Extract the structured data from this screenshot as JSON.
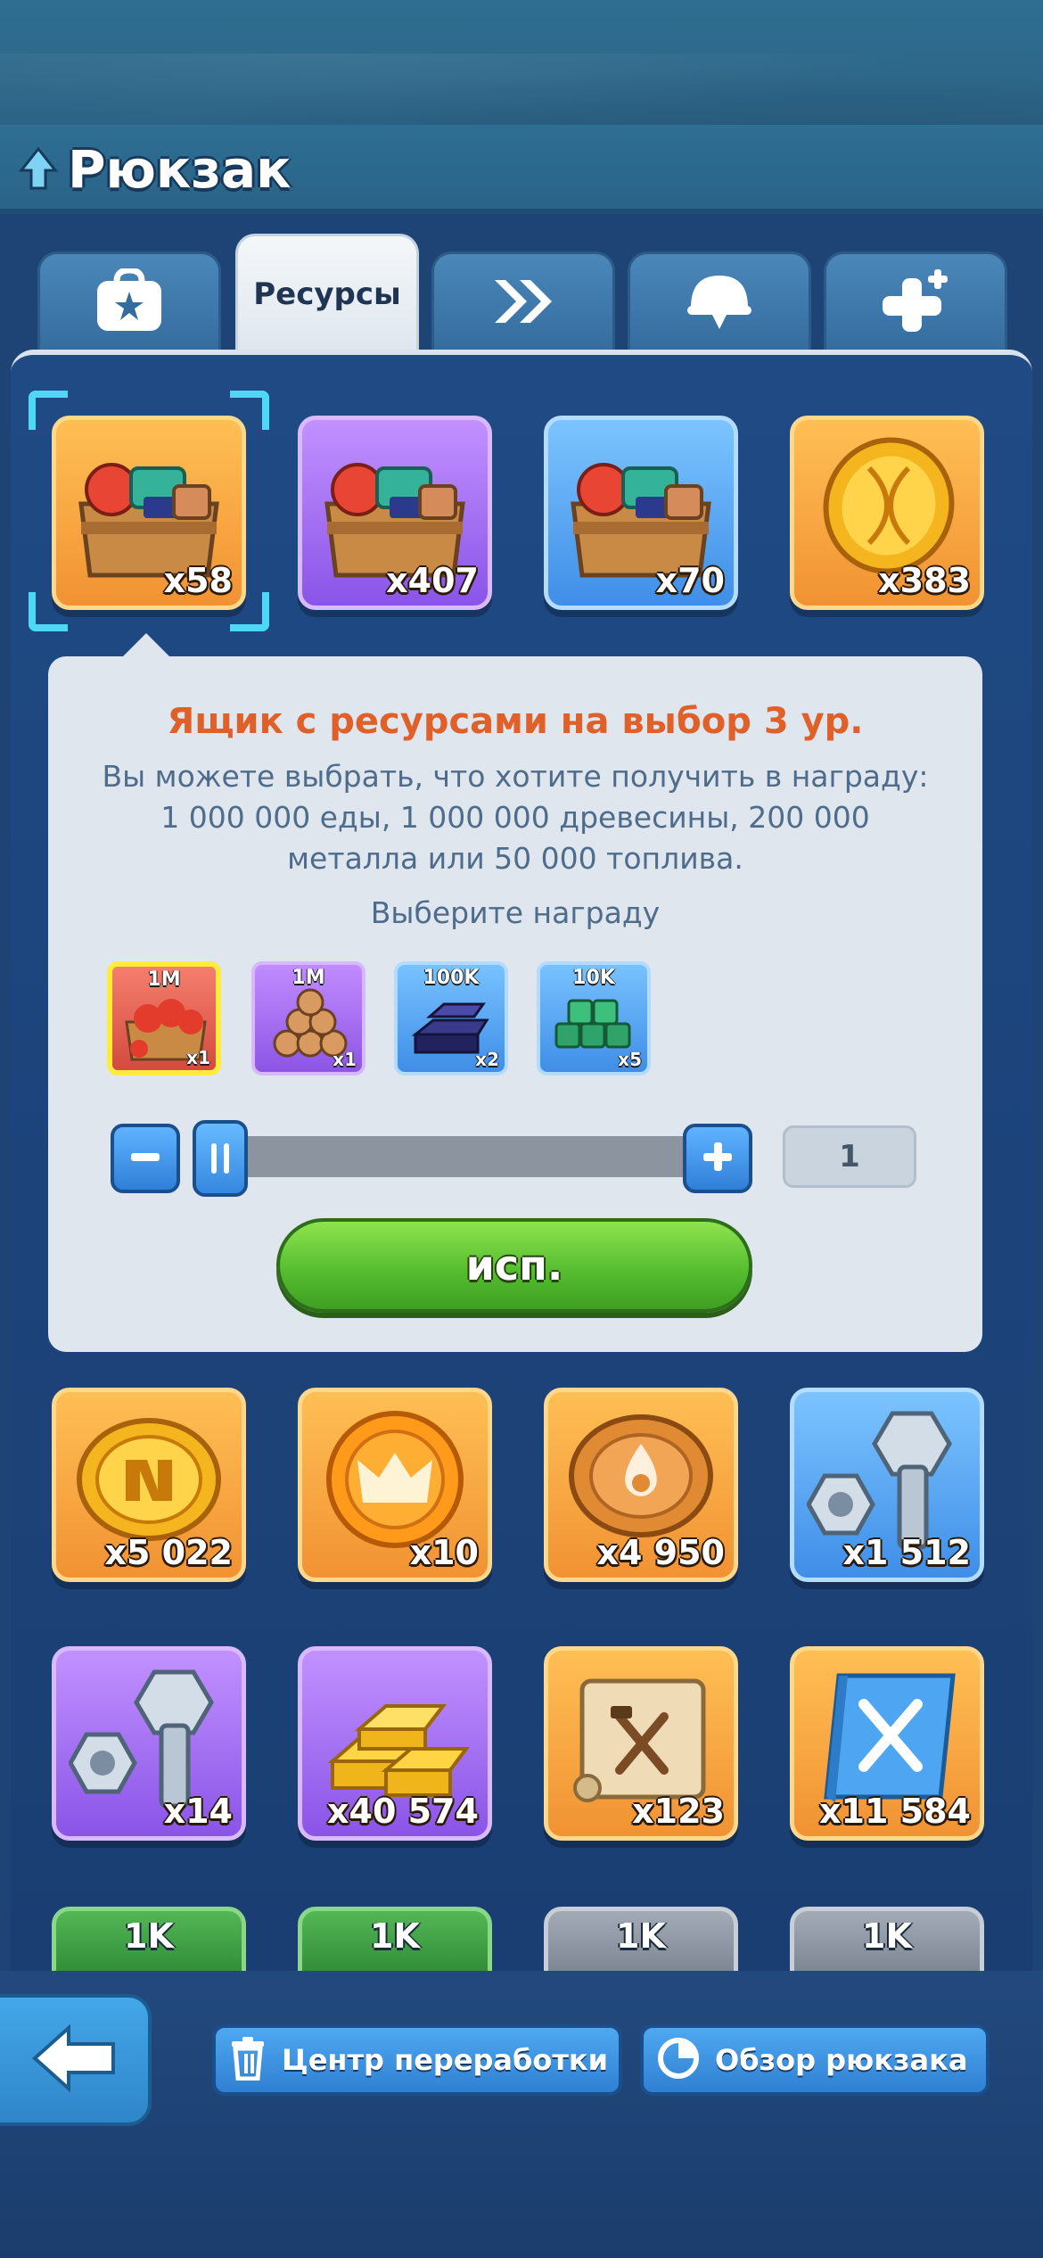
{
  "header": {
    "title": "Рюкзак"
  },
  "tabs": [
    {
      "icon": "backpack-star-icon",
      "label": ""
    },
    {
      "icon": "",
      "label": "Ресурсы",
      "active": true
    },
    {
      "icon": "double-chevron-icon",
      "label": ""
    },
    {
      "icon": "helmet-icon",
      "label": ""
    },
    {
      "icon": "plus-sparkle-icon",
      "label": ""
    }
  ],
  "items_row1": [
    {
      "icon": "resource-chest-icon",
      "rarity": "orange",
      "qty": "x58",
      "selected": true
    },
    {
      "icon": "resource-chest-icon",
      "rarity": "purple",
      "qty": "x407"
    },
    {
      "icon": "resource-chest-icon",
      "rarity": "blue",
      "qty": "x70"
    },
    {
      "icon": "dna-coin-icon",
      "rarity": "orange",
      "qty": "x383"
    }
  ],
  "tooltip": {
    "title": "Ящик с ресурсами на выбор 3 ур.",
    "description": "Вы можете выбрать, что хотите получить в награду: 1 000 000 еды, 1 000 000 древесины, 200 000 металла или 50 000 топлива.",
    "choose_label": "Выберите награду",
    "rewards": [
      {
        "icon": "food-tomato-crate-icon",
        "amount": "1M",
        "qty": "x1",
        "selected": true
      },
      {
        "icon": "wood-logs-icon",
        "amount": "1M",
        "qty": "x1"
      },
      {
        "icon": "metal-ingots-icon",
        "amount": "100K",
        "qty": "x2"
      },
      {
        "icon": "fuel-cubes-icon",
        "amount": "10K",
        "qty": "x5"
      }
    ],
    "quantity": "1",
    "use_button": "исп."
  },
  "items_row2": [
    {
      "icon": "n-coin-icon",
      "rarity": "orange",
      "qty": "x5 022"
    },
    {
      "icon": "crown-coin-icon",
      "rarity": "orange",
      "qty": "x10"
    },
    {
      "icon": "drop-coin-icon",
      "rarity": "orange",
      "qty": "x4 950"
    },
    {
      "icon": "bolt-nut-icon",
      "rarity": "blue",
      "qty": "x1 512"
    }
  ],
  "items_row3": [
    {
      "icon": "bolt-nut-icon",
      "rarity": "purple",
      "qty": "x14"
    },
    {
      "icon": "gold-bars-icon",
      "rarity": "purple",
      "qty": "x40 574"
    },
    {
      "icon": "blueprint-scroll-icon",
      "rarity": "orange",
      "qty": "x123"
    },
    {
      "icon": "sword-book-icon",
      "rarity": "orange",
      "qty": "x11 584"
    }
  ],
  "items_row4": [
    {
      "rarity": "green",
      "label": "1K"
    },
    {
      "rarity": "green",
      "label": "1K"
    },
    {
      "rarity": "gray",
      "label": "1K"
    },
    {
      "rarity": "gray",
      "label": "1K"
    }
  ],
  "bottom": {
    "recycle_label": "Центр переработки",
    "overview_label": "Обзор рюкзака"
  },
  "colors": {
    "accent_orange_title": "#e0602a",
    "use_button_green": "#53bb2e",
    "selection_cyan": "#4fd8f5"
  }
}
